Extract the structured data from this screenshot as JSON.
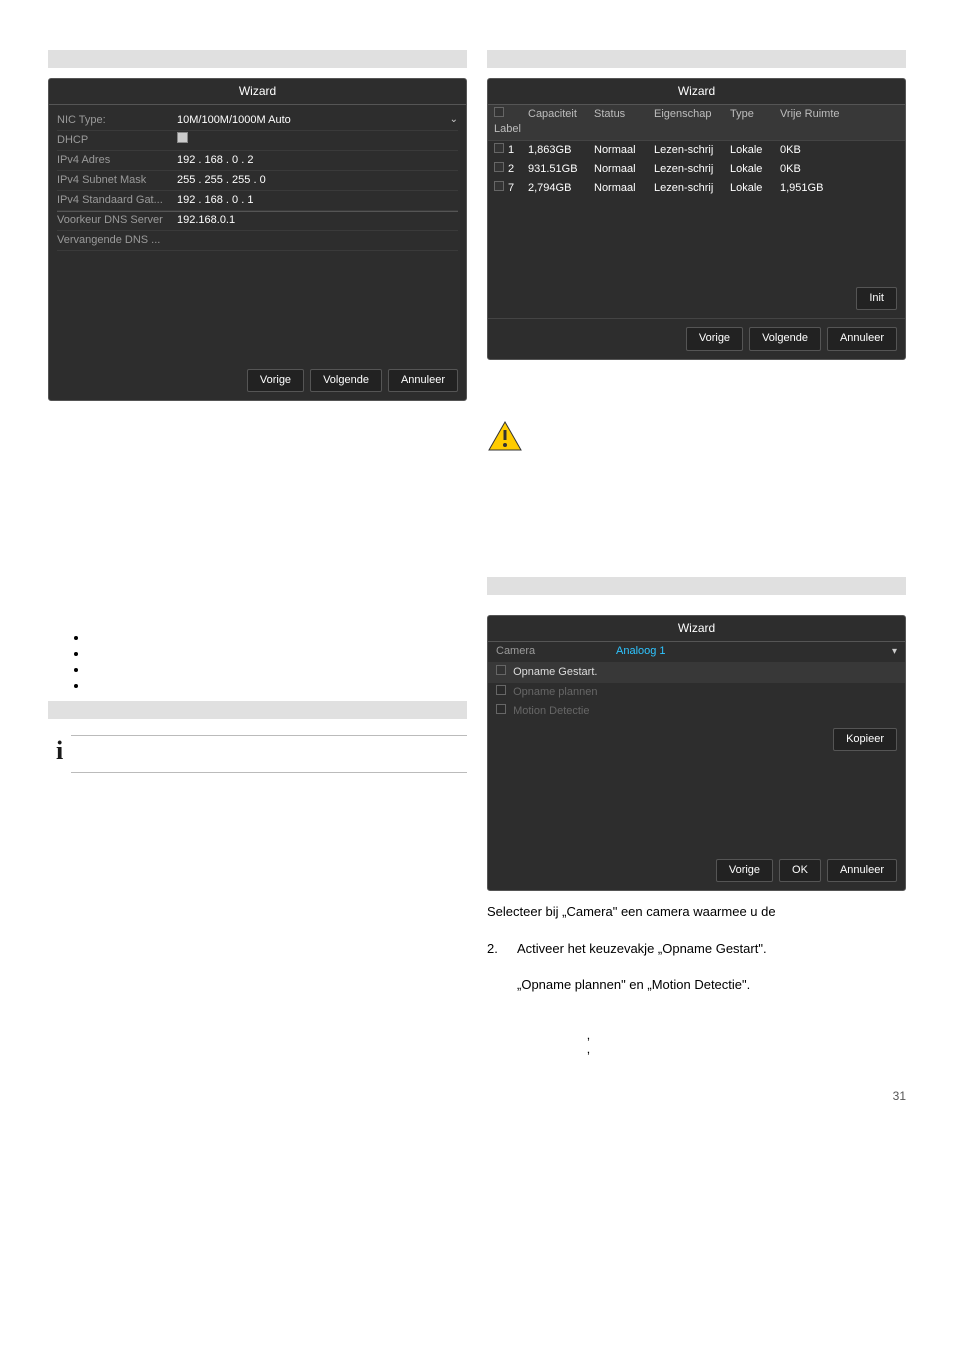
{
  "wizard1": {
    "title": "Wizard",
    "rows": {
      "nic_label": "NIC Type:",
      "nic_value": "10M/100M/1000M Auto",
      "dhcp_label": "DHCP",
      "ipv4_addr_label": "IPv4 Adres",
      "ipv4_addr_value": "192 . 168 . 0    . 2",
      "ipv4_mask_label": "IPv4 Subnet Mask",
      "ipv4_mask_value": "255 . 255 . 255 . 0",
      "ipv4_gw_label": "IPv4 Standaard Gat...",
      "ipv4_gw_value": "192 . 168 . 0    . 1",
      "dns1_label": "Voorkeur DNS Server",
      "dns1_value": "192.168.0.1",
      "dns2_label": "Vervangende DNS ..."
    },
    "buttons": {
      "prev": "Vorige",
      "next": "Volgende",
      "cancel": "Annuleer"
    }
  },
  "wizard2": {
    "title": "Wizard",
    "headers": {
      "label": "Label",
      "cap": "Capaciteit",
      "status": "Status",
      "prop": "Eigenschap",
      "type": "Type",
      "free": "Vrije Ruimte"
    },
    "rows": [
      {
        "id": "1",
        "cap": "1,863GB",
        "status": "Normaal",
        "prop": "Lezen-schrij",
        "type": "Lokale",
        "free": "0KB"
      },
      {
        "id": "2",
        "cap": "931.51GB",
        "status": "Normaal",
        "prop": "Lezen-schrij",
        "type": "Lokale",
        "free": "0KB"
      },
      {
        "id": "7",
        "cap": "2,794GB",
        "status": "Normaal",
        "prop": "Lezen-schrij",
        "type": "Lokale",
        "free": "1,951GB"
      }
    ],
    "init": "Init",
    "buttons": {
      "prev": "Vorige",
      "next": "Volgende",
      "cancel": "Annuleer"
    }
  },
  "wizard3": {
    "title": "Wizard",
    "camera_label": "Camera",
    "camera_value": "Analoog 1",
    "opname_gestart": "Opname Gestart.",
    "opname_plannen": "Opname plannen",
    "motion": "Motion Detectie",
    "copy": "Kopieer",
    "buttons": {
      "prev": "Vorige",
      "ok": "OK",
      "cancel": "Annuleer"
    }
  },
  "text": {
    "select_camera": "Selecteer bij „Camera\" een camera waarmee u de",
    "step2_num": "2.",
    "step2": "Activeer het keuzevakje „Opname Gestart\".",
    "step_after": "„Opname plannen\" en „Motion Detectie\".",
    "apost1": "‚",
    "apost2": "‚",
    "page_num": "31"
  }
}
